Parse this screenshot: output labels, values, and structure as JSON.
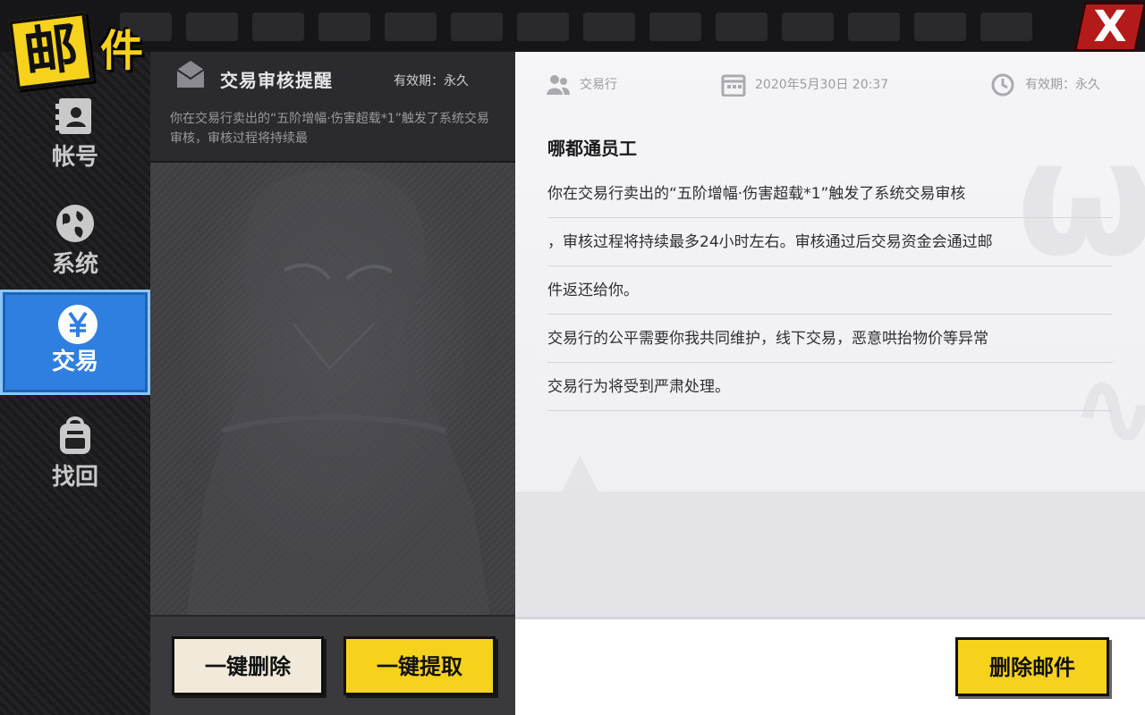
{
  "header": {
    "logo_main": "邮",
    "logo_sub": "件",
    "close_label": "X"
  },
  "sidebar": {
    "items": [
      {
        "label": "帐号",
        "icon": "id-card-icon",
        "active": false
      },
      {
        "label": "系统",
        "icon": "globe-icon",
        "active": false
      },
      {
        "label": "交易",
        "icon": "yen-icon",
        "active": true
      },
      {
        "label": "找回",
        "icon": "backpack-icon",
        "active": false
      }
    ]
  },
  "mail_list": {
    "items": [
      {
        "title": "交易审核提醒",
        "expiry": "有效期：永久",
        "preview": "你在交易行卖出的“五阶增幅·伤害超载*1”触发了系统交易审核，审核过程将持续最"
      }
    ],
    "buttons": {
      "delete_all": "一键删除",
      "claim_all": "一键提取"
    }
  },
  "detail": {
    "sender": "交易行",
    "date": "2020年5月30日 20:37",
    "expiry": "有效期：永久",
    "recipient": "哪都通员工",
    "lines": [
      "你在交易行卖出的“五阶增幅·伤害超载*1”触发了系统交易审核",
      "，审核过程将持续最多24小时左右。审核通过后交易资金会通过邮",
      "件返还给你。",
      "交易行的公平需要你我共同维护，线下交易，恶意哄抬物价等异常",
      "交易行为将受到严肃处理。"
    ],
    "delete_button": "删除邮件"
  },
  "colors": {
    "accent_yellow": "#f7d21d",
    "active_blue": "#2f7fe0",
    "close_red": "#b51a1a"
  }
}
